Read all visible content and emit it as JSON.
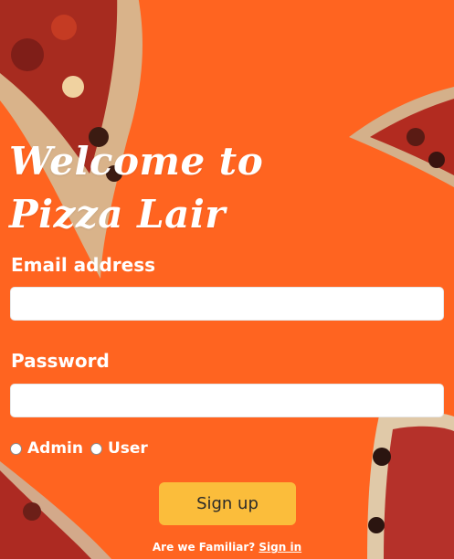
{
  "title": "Welcome to Pizza Lair",
  "form": {
    "email_label": "Email address",
    "email_value": "",
    "password_label": "Password",
    "password_value": "",
    "roles": [
      "Admin",
      "User"
    ],
    "submit_label": "Sign up"
  },
  "footer": {
    "prompt": "Are we Familiar?",
    "link_label": "Sign in"
  },
  "colors": {
    "background": "#ff6420",
    "button": "#fbbd3b",
    "text": "#ffffff"
  }
}
